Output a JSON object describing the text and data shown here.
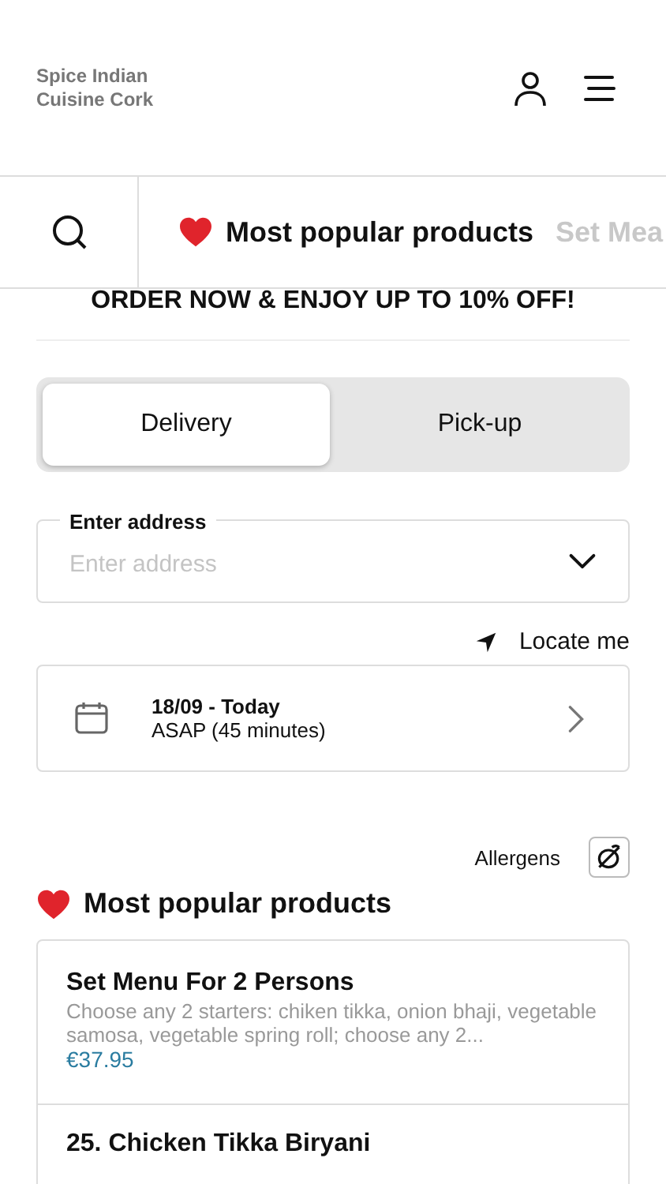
{
  "header": {
    "restaurant_name": "Spice Indian Cuisine Cork"
  },
  "category_tabs": [
    {
      "label": "Most popular products",
      "selected": true,
      "kind": "favorite"
    },
    {
      "label": "Set Mea",
      "selected": false,
      "kind": "plain"
    }
  ],
  "promo": "ORDER NOW & ENJOY UP TO 10% OFF!",
  "order_type": [
    {
      "label": "Delivery",
      "selected": true
    },
    {
      "label": "Pick-up",
      "selected": false
    }
  ],
  "address": {
    "label": "Enter address",
    "placeholder": "Enter address"
  },
  "locate_me": "Locate me",
  "schedule": {
    "date": "18/09 - Today",
    "time": "ASAP (45 minutes)"
  },
  "allergens": "Allergens",
  "section_title": "Most popular products",
  "products": [
    {
      "name": "Set Menu For 2 Persons",
      "description": "Choose any 2 starters: chiken tikka, onion bhaji, vegetable samosa, vegetable spring roll; choose any 2...",
      "price": "€37.95"
    },
    {
      "name": "25. Chicken Tikka Biryani"
    }
  ]
}
